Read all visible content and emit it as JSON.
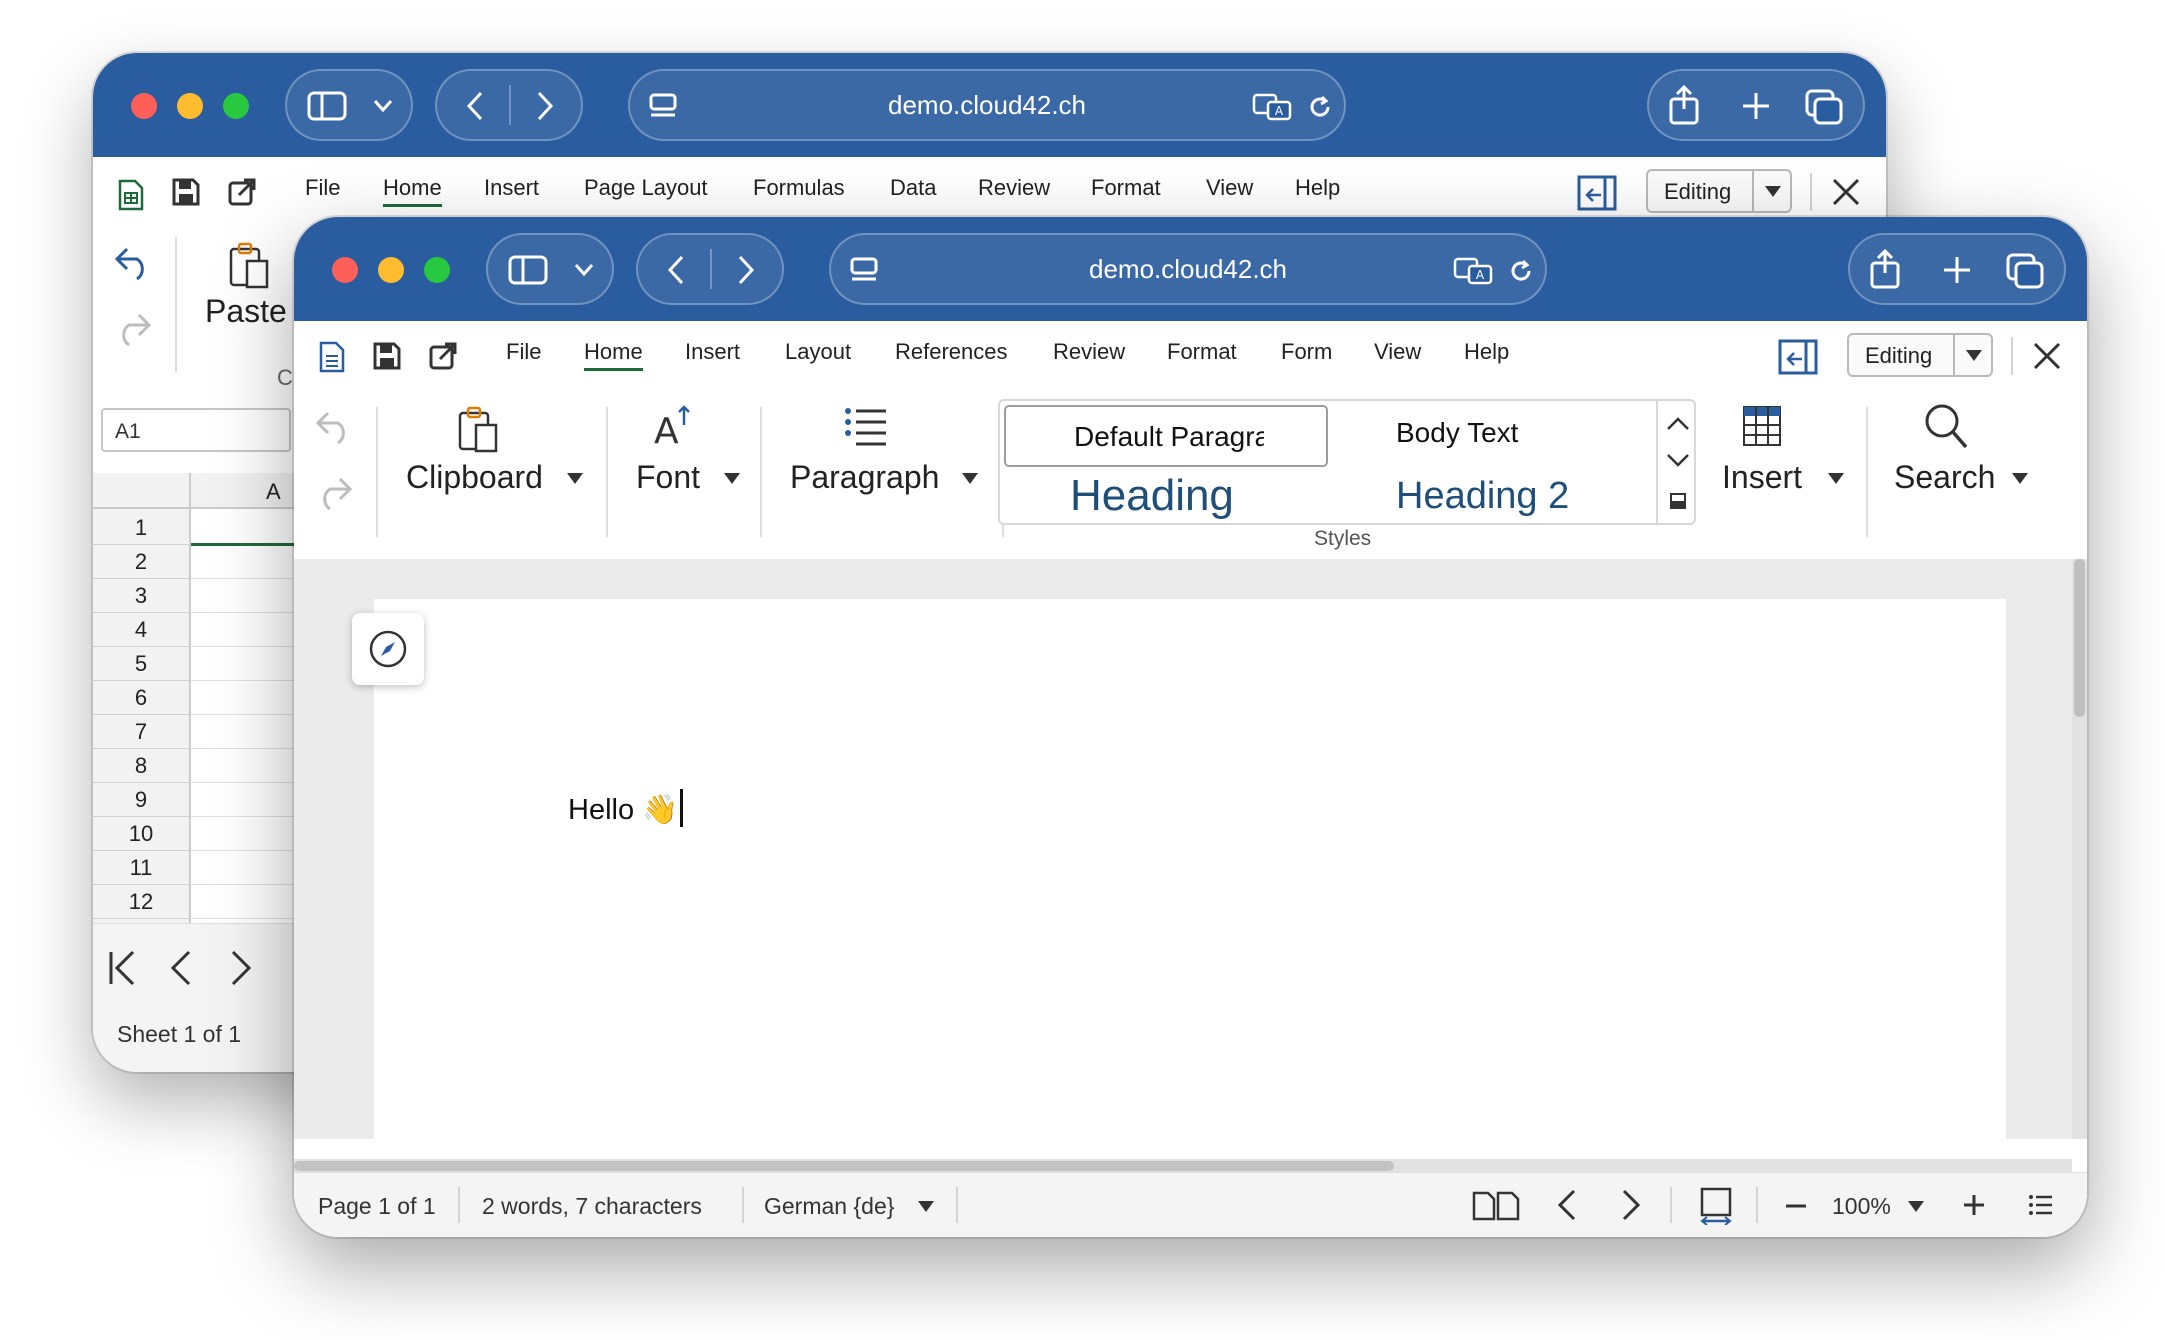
{
  "back_window": {
    "url": "demo.cloud42.ch",
    "menu": [
      "File",
      "Home",
      "Insert",
      "Page Layout",
      "Formulas",
      "Data",
      "Review",
      "Format",
      "View",
      "Help"
    ],
    "active_menu": "Home",
    "mode": "Editing",
    "paste_label": "Paste",
    "clipboard_group_partial": "C",
    "name_box": "A1",
    "column_header": "A",
    "rows": [
      "1",
      "2",
      "3",
      "4",
      "5",
      "6",
      "7",
      "8",
      "9",
      "10",
      "11",
      "12"
    ],
    "sheet_status": "Sheet 1 of 1"
  },
  "front_window": {
    "url": "demo.cloud42.ch",
    "menu": [
      "File",
      "Home",
      "Insert",
      "Layout",
      "References",
      "Review",
      "Format",
      "Form",
      "View",
      "Help"
    ],
    "active_menu": "Home",
    "mode": "Editing",
    "ribbon": {
      "clipboard": "Clipboard",
      "font": "Font",
      "paragraph": "Paragraph",
      "styles": [
        "Default Paragra",
        "Body Text",
        "Heading",
        "Heading 2"
      ],
      "styles_group": "Styles",
      "insert": "Insert",
      "search": "Search"
    },
    "document_text": "Hello 👋",
    "status": {
      "page": "Page 1 of 1",
      "count": "2 words, 7 characters",
      "language": "German {de}",
      "zoom": "100%"
    }
  },
  "colors": {
    "titlebar": "#2a5d9f",
    "accent_green": "#1e6b3a",
    "heading": "#1f4e79"
  }
}
